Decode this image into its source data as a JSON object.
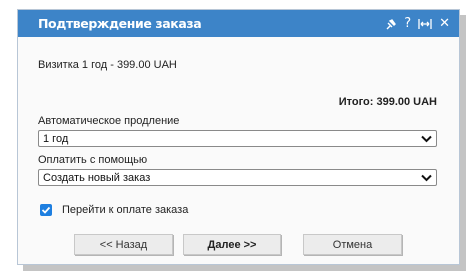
{
  "dialog": {
    "title": "Подтверждение заказа",
    "icons": [
      "pin-icon",
      "help-icon",
      "resize-icon",
      "close-icon"
    ],
    "help_glyph": "?",
    "close_glyph": "✕"
  },
  "order": {
    "product_line": "Визитка 1 год - 399.00 UAH",
    "total": "Итого: 399.00 UAH"
  },
  "renewal": {
    "label": "Автоматическое продление",
    "selected": "1 год"
  },
  "payment": {
    "label": "Оплатить с помощью",
    "selected": "Создать новый заказ"
  },
  "proceed_checkbox": {
    "label": "Перейти к оплате заказа",
    "checked": true
  },
  "buttons": {
    "back": "<< Назад",
    "next": "Далее >>",
    "cancel": "Отмена"
  },
  "colors": {
    "titlebar": "#3d84c8",
    "checkbox": "#1e7fe0"
  }
}
